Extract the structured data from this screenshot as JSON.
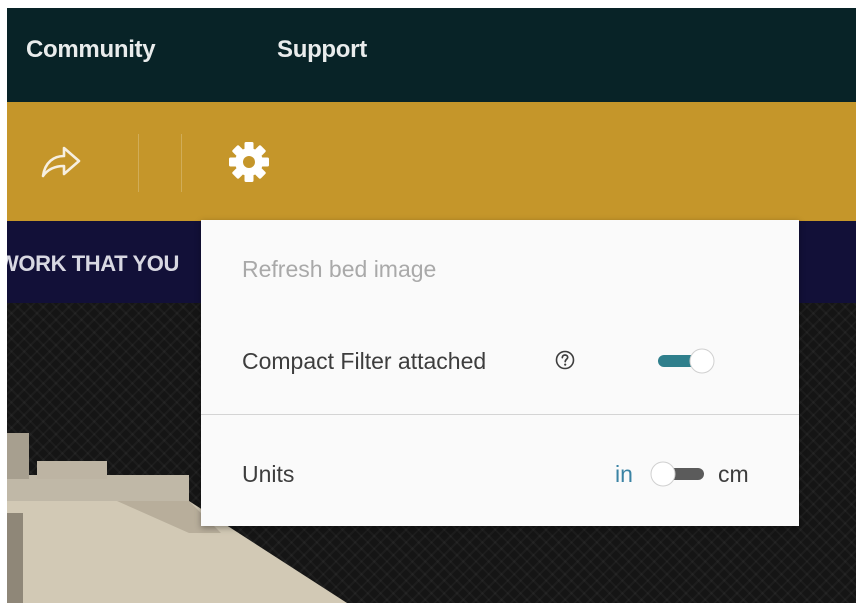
{
  "nav": {
    "community": "Community",
    "support": "Support"
  },
  "toolbar": {
    "share_icon": "share-arrow-icon",
    "settings_icon": "gear-icon"
  },
  "banner": {
    "text": "WORK THAT YOU"
  },
  "settings_menu": {
    "refresh_label": "Refresh bed image",
    "compact_filter_label": "Compact Filter attached",
    "compact_filter_help_icon": "question-circle-icon",
    "compact_filter_enabled": true,
    "units_label": "Units",
    "unit_left": "in",
    "unit_right": "cm",
    "selected_unit": "in"
  },
  "colors": {
    "nav_bg": "#082327",
    "toolbar_bg": "#c5962a",
    "banner_bg": "#121038",
    "accent_teal": "#2f7f8c",
    "unit_active": "#3a83a4"
  }
}
